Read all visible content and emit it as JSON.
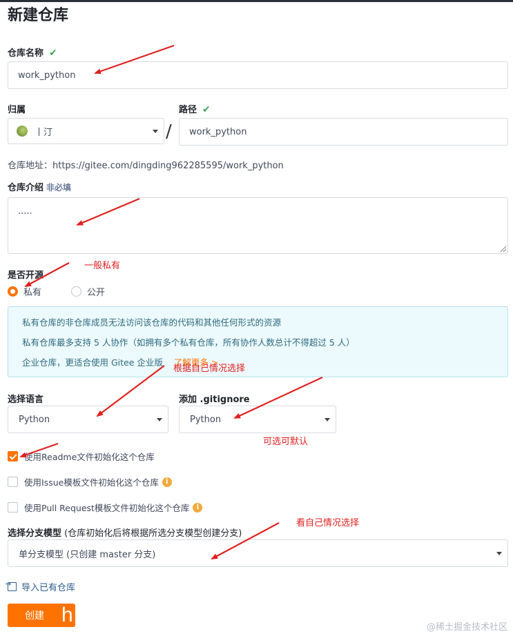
{
  "page": {
    "title": "新建仓库"
  },
  "repo_name": {
    "label": "仓库名称",
    "check": "✔",
    "value": "work_python"
  },
  "owner": {
    "label": "归属",
    "value": "丨汀"
  },
  "path": {
    "label": "路径",
    "check": "✔",
    "value": "work_python",
    "separator": "/"
  },
  "repo_address": {
    "text": "仓库地址：https://gitee.com/dingding962285595/work_python"
  },
  "description": {
    "label": "仓库介绍",
    "optional": "非必填",
    "value": "....."
  },
  "visibility": {
    "label": "是否开源",
    "options": [
      "私有",
      "公开"
    ],
    "selected": "私有"
  },
  "info": {
    "line1": "私有仓库的非仓库成员无法访问该仓库的代码和其他任何形式的资源",
    "line2": "私有仓库最多支持 5 人协作（如拥有多个私有仓库，所有协作人数总计不得超过 5 人）",
    "line3": "企业仓库，更适合使用 Gitee 企业版",
    "more_link": "了解更多 >"
  },
  "language": {
    "label": "选择语言",
    "value": "Python"
  },
  "gitignore": {
    "label": "添加 .gitignore",
    "value": "Python"
  },
  "init_options": [
    {
      "label": "使用Readme文件初始化这个仓库",
      "checked": true
    },
    {
      "label": "使用Issue模板文件初始化这个仓库",
      "checked": false,
      "icon": "info-icon"
    },
    {
      "label": "使用Pull Request模板文件初始化这个仓库",
      "checked": false,
      "icon": "info-icon"
    }
  ],
  "branch_model": {
    "label": "选择分支模型",
    "hint": "(仓库初始化后将根据所选分支模型创建分支)",
    "value": "单分支模型 (只创建 master 分支)"
  },
  "import_link": "导入已有仓库",
  "create_button": {
    "label": "创建",
    "cursor_glyph": "h"
  },
  "annotations": {
    "private": "一般私有",
    "language": "根据自己情况选择",
    "gitignore": "可选可默认",
    "branch": "看自己情况选择"
  },
  "watermark": "@稀土掘金技术社区",
  "colors": {
    "accent": "#fe7300",
    "check": "#3fa45b",
    "annotation": "#e02020",
    "info_bg": "#ecf9fd",
    "link": "#2d5d8c"
  }
}
